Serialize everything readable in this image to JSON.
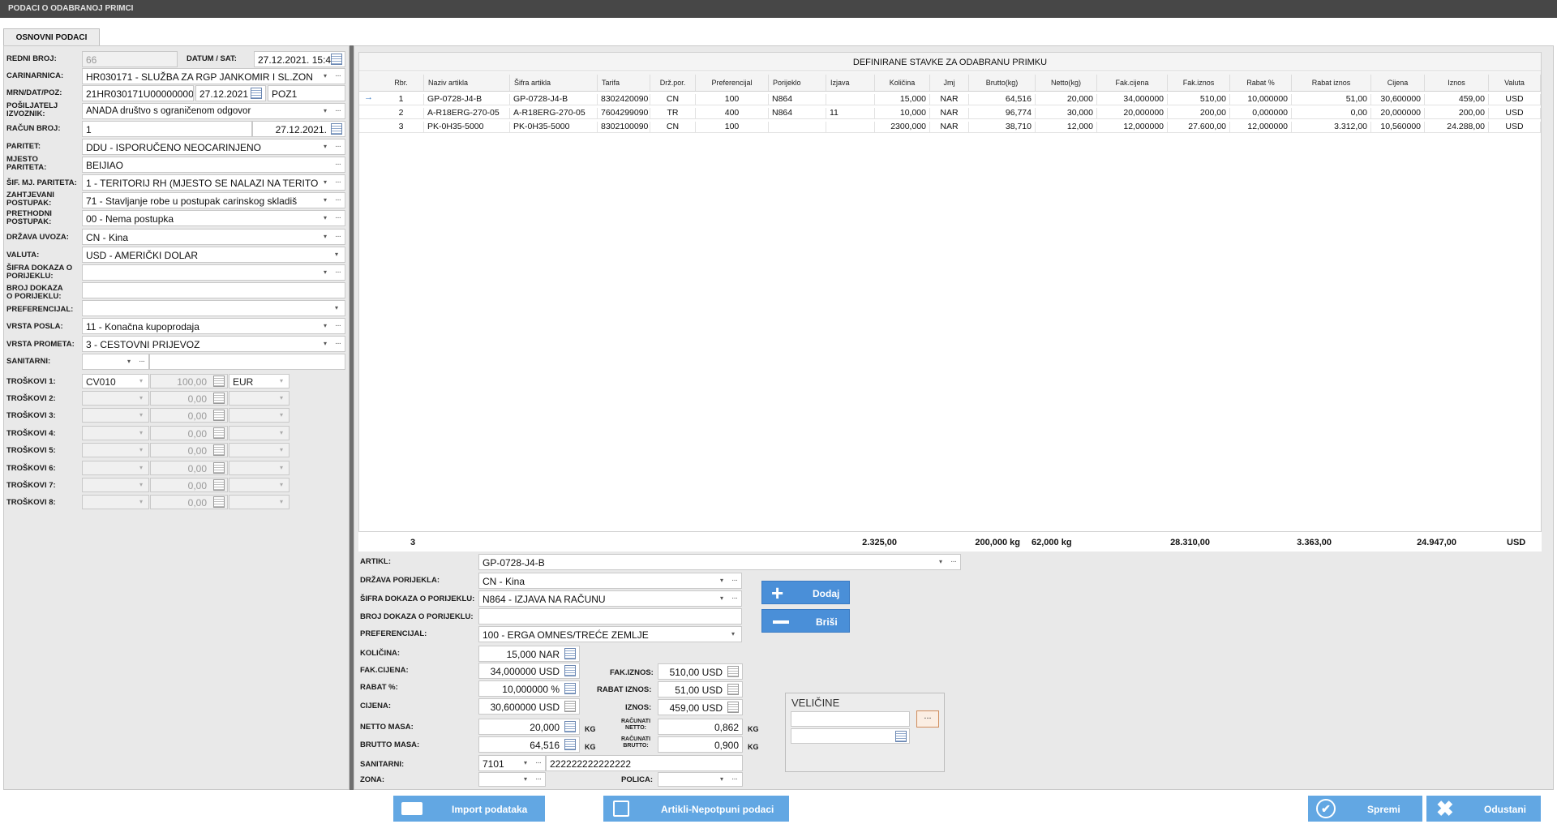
{
  "window": {
    "title": "PODACI O ODABRANOJ PRIMCI"
  },
  "tab": {
    "label": "OSNOVNI PODACI"
  },
  "left": {
    "redni_label": "REDNI BROJ:",
    "redni_value": "66",
    "datum_label": "DATUM / SAT:",
    "datum_value": "27.12.2021. 15:4",
    "carinarnica_label": "CARINARNICA:",
    "carinarnica_value": "HR030171 - SLUŽBA ZA RGP JANKOMIR I SL.ZON",
    "mrn_label": "MRN/DAT/POZ:",
    "mrn_value": "21HR030171U000000000",
    "mrn_date": "27.12.2021",
    "mrn_poz": "POZ1",
    "posiljatelj_label1": "POŠILJATELJ",
    "posiljatelj_label2": "IZVOZNIK:",
    "posiljatelj_value": "ANADA društvo s ograničenom odgovor",
    "racun_label": "RAČUN BROJ:",
    "racun_value": "1",
    "racun_date": "27.12.2021.",
    "paritet_label": "PARITET:",
    "paritet_value": "DDU - ISPORUČENO NEOCARINJENO",
    "mjesto_label1": "MJESTO",
    "mjesto_label2": "PARITETA:",
    "mjesto_value": "BEIJIAO",
    "sif_label": "ŠIF. MJ. PARITETA:",
    "sif_value": "1 - TERITORIJ RH (MJESTO SE NALAZI NA TERITO",
    "zaht_label1": "ZAHTJEVANI",
    "zaht_label2": "POSTUPAK:",
    "zaht_value": "71 - Stavljanje robe u postupak carinskog skladiš",
    "preth_label1": "PRETHODNI",
    "preth_label2": "POSTUPAK:",
    "preth_value": "00 - Nema postupka",
    "drzava_label": "DRŽAVA UVOZA:",
    "drzava_value": "CN - Kina",
    "valuta_label": "VALUTA:",
    "valuta_value": "USD - AMERIČKI DOLAR",
    "sifdok_label1": "ŠIFRA DOKAZA O",
    "sifdok_label2": "PORIJEKLU:",
    "brdok_label1": "BROJ DOKAZA",
    "brdok_label2": "O PORIJEKLU:",
    "pref_label": "PREFERENCIJAL:",
    "vrsta_posla_label": "VRSTA POSLA:",
    "vrsta_posla_value": "11 - Konačna kupoprodaja",
    "vrsta_prometa_label": "VRSTA PROMETA:",
    "vrsta_prometa_value": "3 - CESTOVNI PRIJEVOZ",
    "sanitarni_label": "SANITARNI:",
    "troskovi": [
      {
        "label": "TROŠKOVI 1:",
        "code": "CV010",
        "amount": "100,00",
        "currency": "EUR"
      },
      {
        "label": "TROŠKOVI 2:",
        "code": "",
        "amount": "0,00",
        "currency": ""
      },
      {
        "label": "TROŠKOVI 3:",
        "code": "",
        "amount": "0,00",
        "currency": ""
      },
      {
        "label": "TROŠKOVI 4:",
        "code": "",
        "amount": "0,00",
        "currency": ""
      },
      {
        "label": "TROŠKOVI 5:",
        "code": "",
        "amount": "0,00",
        "currency": ""
      },
      {
        "label": "TROŠKOVI 6:",
        "code": "",
        "amount": "0,00",
        "currency": ""
      },
      {
        "label": "TROŠKOVI 7:",
        "code": "",
        "amount": "0,00",
        "currency": ""
      },
      {
        "label": "TROŠKOVI 8:",
        "code": "",
        "amount": "0,00",
        "currency": ""
      }
    ]
  },
  "grid": {
    "title": "DEFINIRANE STAVKE ZA ODABRANU PRIMKU",
    "columns": [
      "Rbr.",
      "Naziv artikla",
      "Šifra artikla",
      "Tarifa",
      "Drž.por.",
      "Preferencijal",
      "Porijeklo",
      "Izjava",
      "Količina",
      "Jmj",
      "Brutto(kg)",
      "Netto(kg)",
      "Fak.cijena",
      "Fak.iznos",
      "Rabat %",
      "Rabat iznos",
      "Cijena",
      "Iznos",
      "Valuta"
    ],
    "rows": [
      [
        "1",
        "GP-0728-J4-B",
        "GP-0728-J4-B",
        "8302420090",
        "CN",
        "100",
        "N864",
        "",
        "15,000",
        "NAR",
        "64,516",
        "20,000",
        "34,000000",
        "510,00",
        "10,000000",
        "51,00",
        "30,600000",
        "459,00",
        "USD"
      ],
      [
        "2",
        "A-R18ERG-270-05",
        "A-R18ERG-270-05",
        "7604299090",
        "TR",
        "400",
        "N864",
        "11",
        "10,000",
        "NAR",
        "96,774",
        "30,000",
        "20,000000",
        "200,00",
        "0,000000",
        "0,00",
        "20,000000",
        "200,00",
        "USD"
      ],
      [
        "3",
        "PK-0H35-5000",
        "PK-0H35-5000",
        "8302100090",
        "CN",
        "100",
        "",
        "",
        "2300,000",
        "NAR",
        "38,710",
        "12,000",
        "12,000000",
        "27.600,00",
        "12,000000",
        "3.312,00",
        "10,560000",
        "24.288,00",
        "USD"
      ]
    ],
    "footer": {
      "count": "3",
      "kolicina": "2.325,00",
      "brutto": "200,000 kg",
      "netto": "62,000 kg",
      "fak_iznos": "28.310,00",
      "rabat_iznos": "3.363,00",
      "iznos": "24.947,00",
      "valuta": "USD"
    }
  },
  "detail": {
    "artikl_label": "ARTIKL:",
    "artikl_value": "GP-0728-J4-B",
    "drzava_label": "DRŽAVA PORIJEKLA:",
    "drzava_value": "CN - Kina",
    "sifra_label": "ŠIFRA DOKAZA O PORIJEKLU:",
    "sifra_value": "N864 - IZJAVA NA RAČUNU",
    "broj_label": "BROJ DOKAZA O PORIJEKLU:",
    "pref_label": "PREFERENCIJAL:",
    "pref_value": "100 - ERGA OMNES/TREĆE ZEMLJE",
    "kolicina_label": "KOLIČINA:",
    "kolicina_value": "15,000 NAR",
    "fakcijena_label": "FAK.CIJENA:",
    "fakcijena_value": "34,000000 USD",
    "fakiznos_label": "FAK.IZNOS:",
    "fakiznos_value": "510,00 USD",
    "rabat_label": "RABAT %:",
    "rabat_value": "10,000000 %",
    "rabatiznos_label": "RABAT IZNOS:",
    "rabatiznos_value": "51,00 USD",
    "cijena_label": "CIJENA:",
    "cijena_value": "30,600000 USD",
    "iznos_label": "IZNOS:",
    "iznos_value": "459,00 USD",
    "netto_label": "NETTO MASA:",
    "netto_value": "20,000",
    "kg": "KG",
    "racnetto_label1": "RAČUNATI",
    "racnetto_label2": "NETTO:",
    "racnetto_value": "0,862",
    "brutto_label": "BRUTTO MASA:",
    "brutto_value": "64,516",
    "racbrutto_label1": "RAČUNATI",
    "racbrutto_label2": "BRUTTO:",
    "racbrutto_value": "0,900",
    "sanitarni_label": "SANITARNI:",
    "sanitarni_code": "7101",
    "sanitarni_value": "222222222222222",
    "zona_label": "ZONA:",
    "polica_label": "POLICA:",
    "velicine_title": "VELIČINE",
    "dodaj_label": "Dodaj",
    "brisi_label": "Briši"
  },
  "buttons": {
    "import": "Import podataka",
    "artikli": "Artikli-Nepotpuni podaci",
    "spremi": "Spremi",
    "odustani": "Odustani"
  }
}
